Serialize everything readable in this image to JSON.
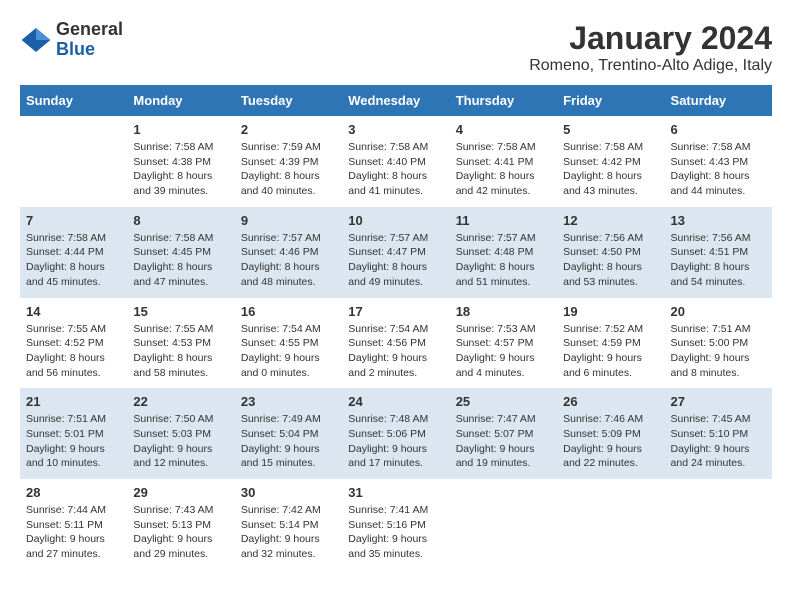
{
  "logo": {
    "general": "General",
    "blue": "Blue"
  },
  "header": {
    "month": "January 2024",
    "location": "Romeno, Trentino-Alto Adige, Italy"
  },
  "weekdays": [
    "Sunday",
    "Monday",
    "Tuesday",
    "Wednesday",
    "Thursday",
    "Friday",
    "Saturday"
  ],
  "weeks": [
    [
      {
        "day": "",
        "info": ""
      },
      {
        "day": "1",
        "info": "Sunrise: 7:58 AM\nSunset: 4:38 PM\nDaylight: 8 hours\nand 39 minutes."
      },
      {
        "day": "2",
        "info": "Sunrise: 7:59 AM\nSunset: 4:39 PM\nDaylight: 8 hours\nand 40 minutes."
      },
      {
        "day": "3",
        "info": "Sunrise: 7:58 AM\nSunset: 4:40 PM\nDaylight: 8 hours\nand 41 minutes."
      },
      {
        "day": "4",
        "info": "Sunrise: 7:58 AM\nSunset: 4:41 PM\nDaylight: 8 hours\nand 42 minutes."
      },
      {
        "day": "5",
        "info": "Sunrise: 7:58 AM\nSunset: 4:42 PM\nDaylight: 8 hours\nand 43 minutes."
      },
      {
        "day": "6",
        "info": "Sunrise: 7:58 AM\nSunset: 4:43 PM\nDaylight: 8 hours\nand 44 minutes."
      }
    ],
    [
      {
        "day": "7",
        "info": "Sunrise: 7:58 AM\nSunset: 4:44 PM\nDaylight: 8 hours\nand 45 minutes."
      },
      {
        "day": "8",
        "info": "Sunrise: 7:58 AM\nSunset: 4:45 PM\nDaylight: 8 hours\nand 47 minutes."
      },
      {
        "day": "9",
        "info": "Sunrise: 7:57 AM\nSunset: 4:46 PM\nDaylight: 8 hours\nand 48 minutes."
      },
      {
        "day": "10",
        "info": "Sunrise: 7:57 AM\nSunset: 4:47 PM\nDaylight: 8 hours\nand 49 minutes."
      },
      {
        "day": "11",
        "info": "Sunrise: 7:57 AM\nSunset: 4:48 PM\nDaylight: 8 hours\nand 51 minutes."
      },
      {
        "day": "12",
        "info": "Sunrise: 7:56 AM\nSunset: 4:50 PM\nDaylight: 8 hours\nand 53 minutes."
      },
      {
        "day": "13",
        "info": "Sunrise: 7:56 AM\nSunset: 4:51 PM\nDaylight: 8 hours\nand 54 minutes."
      }
    ],
    [
      {
        "day": "14",
        "info": "Sunrise: 7:55 AM\nSunset: 4:52 PM\nDaylight: 8 hours\nand 56 minutes."
      },
      {
        "day": "15",
        "info": "Sunrise: 7:55 AM\nSunset: 4:53 PM\nDaylight: 8 hours\nand 58 minutes."
      },
      {
        "day": "16",
        "info": "Sunrise: 7:54 AM\nSunset: 4:55 PM\nDaylight: 9 hours\nand 0 minutes."
      },
      {
        "day": "17",
        "info": "Sunrise: 7:54 AM\nSunset: 4:56 PM\nDaylight: 9 hours\nand 2 minutes."
      },
      {
        "day": "18",
        "info": "Sunrise: 7:53 AM\nSunset: 4:57 PM\nDaylight: 9 hours\nand 4 minutes."
      },
      {
        "day": "19",
        "info": "Sunrise: 7:52 AM\nSunset: 4:59 PM\nDaylight: 9 hours\nand 6 minutes."
      },
      {
        "day": "20",
        "info": "Sunrise: 7:51 AM\nSunset: 5:00 PM\nDaylight: 9 hours\nand 8 minutes."
      }
    ],
    [
      {
        "day": "21",
        "info": "Sunrise: 7:51 AM\nSunset: 5:01 PM\nDaylight: 9 hours\nand 10 minutes."
      },
      {
        "day": "22",
        "info": "Sunrise: 7:50 AM\nSunset: 5:03 PM\nDaylight: 9 hours\nand 12 minutes."
      },
      {
        "day": "23",
        "info": "Sunrise: 7:49 AM\nSunset: 5:04 PM\nDaylight: 9 hours\nand 15 minutes."
      },
      {
        "day": "24",
        "info": "Sunrise: 7:48 AM\nSunset: 5:06 PM\nDaylight: 9 hours\nand 17 minutes."
      },
      {
        "day": "25",
        "info": "Sunrise: 7:47 AM\nSunset: 5:07 PM\nDaylight: 9 hours\nand 19 minutes."
      },
      {
        "day": "26",
        "info": "Sunrise: 7:46 AM\nSunset: 5:09 PM\nDaylight: 9 hours\nand 22 minutes."
      },
      {
        "day": "27",
        "info": "Sunrise: 7:45 AM\nSunset: 5:10 PM\nDaylight: 9 hours\nand 24 minutes."
      }
    ],
    [
      {
        "day": "28",
        "info": "Sunrise: 7:44 AM\nSunset: 5:11 PM\nDaylight: 9 hours\nand 27 minutes."
      },
      {
        "day": "29",
        "info": "Sunrise: 7:43 AM\nSunset: 5:13 PM\nDaylight: 9 hours\nand 29 minutes."
      },
      {
        "day": "30",
        "info": "Sunrise: 7:42 AM\nSunset: 5:14 PM\nDaylight: 9 hours\nand 32 minutes."
      },
      {
        "day": "31",
        "info": "Sunrise: 7:41 AM\nSunset: 5:16 PM\nDaylight: 9 hours\nand 35 minutes."
      },
      {
        "day": "",
        "info": ""
      },
      {
        "day": "",
        "info": ""
      },
      {
        "day": "",
        "info": ""
      }
    ]
  ]
}
